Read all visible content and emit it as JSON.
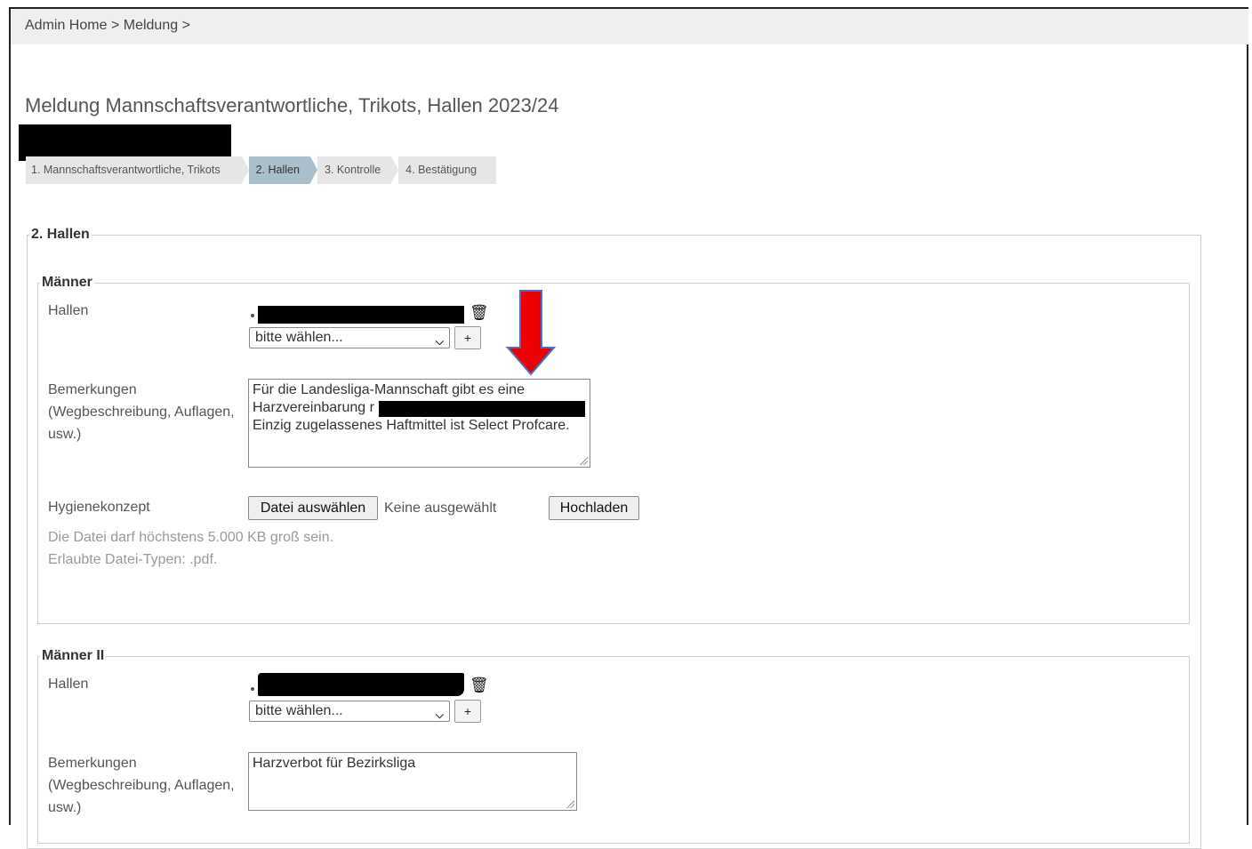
{
  "breadcrumb": {
    "items": [
      "Admin Home",
      ">",
      "Meldung",
      ">"
    ]
  },
  "page": {
    "title": "Meldung Mannschaftsverantwortliche, Trikots, Hallen 2023/24"
  },
  "steps": [
    {
      "label": "1. Mannschaftsverantwortliche, Trikots",
      "active": false
    },
    {
      "label": "2. Hallen",
      "active": true
    },
    {
      "label": "3. Kontrolle",
      "active": false
    },
    {
      "label": "4. Bestätigung",
      "active": false
    }
  ],
  "section": {
    "legend": "2. Hallen"
  },
  "teams": [
    {
      "legend": "Männer",
      "hallen_label": "Hallen",
      "select_value": "bitte wählen...",
      "add_label": "+",
      "remarks_label": "Bemerkungen (Wegbeschreibung, Auflagen, usw.)",
      "remarks_lines": [
        "Für die Landesliga-Mannschaft gibt es eine",
        "Harzvereinbarung r",
        "Einzig zugelassenes Haftmittel ist Select Profcare."
      ],
      "hygiene_label": "Hygienekonzept",
      "file_button": "Datei auswählen",
      "file_status": "Keine ausgewählt",
      "upload_button": "Hochladen",
      "hint_size": "Die Datei darf höchstens 5.000 KB groß sein.",
      "hint_types": "Erlaubte Datei-Typen: .pdf."
    },
    {
      "legend": "Männer II",
      "hallen_label": "Hallen",
      "select_value": "bitte wählen...",
      "add_label": "+",
      "remarks_label": "Bemerkungen (Wegbeschreibung, Auflagen, usw.)",
      "remarks_lines": [
        "Harzverbot für Bezirksliga"
      ]
    }
  ],
  "colors": {
    "step_active": "#aabfcc",
    "step_inactive": "#e6e6e6",
    "arrow_red": "#ee0000",
    "arrow_outline": "#4a6fd0"
  },
  "icons": {
    "delete": "trash-icon",
    "dropdown": "chevron-down-icon",
    "annotation": "red-arrow-down-icon"
  }
}
